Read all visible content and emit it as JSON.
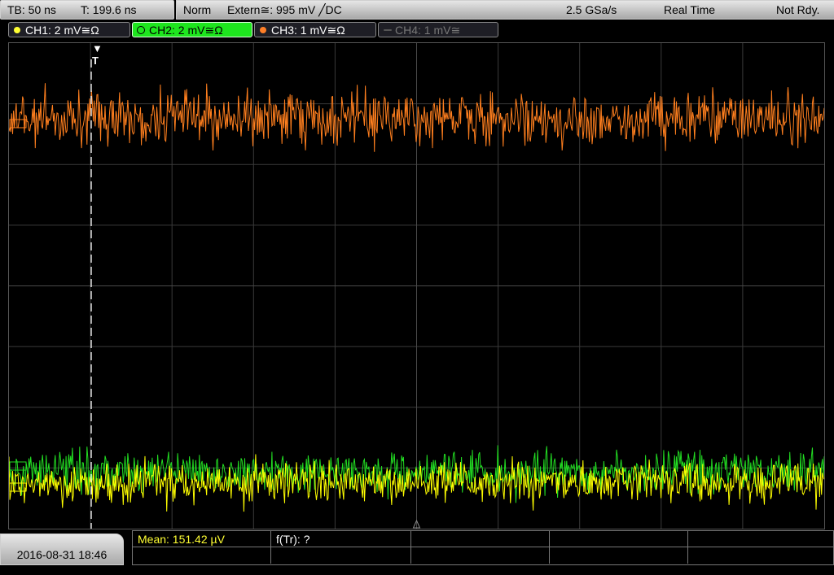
{
  "timebase": {
    "tb_label": "TB: 50 ns",
    "t_label": "T: 199.6 ns"
  },
  "status": {
    "mode": "Norm",
    "trigger": "Extern≅: 995 mV ╱DC",
    "sample_rate": "2.5 GSa/s",
    "acq": "Real Time",
    "ready": "Not Rdy."
  },
  "channels": [
    {
      "label": "CH1: 2 mV≅Ω",
      "color": "#ffff33",
      "state": "on"
    },
    {
      "label": "CH2: 2 mV≅Ω",
      "color": "#1ee61e",
      "state": "active"
    },
    {
      "label": "CH3: 1 mV≅Ω",
      "color": "#ff7f27",
      "state": "on"
    },
    {
      "label": "CH4: 1 mV≅",
      "color": "#777777",
      "state": "off"
    }
  ],
  "colors": {
    "grid": "#3a3a3a",
    "ch1": "#ffff00",
    "ch2": "#22dd22",
    "ch3": "#ff7f1e",
    "trigger_line": "#ffffff"
  },
  "datetime": "2016-08-31 18:46",
  "measurements": {
    "mean": "Mean: 151.42 µV",
    "f_tr": "f(Tr): ?"
  }
}
